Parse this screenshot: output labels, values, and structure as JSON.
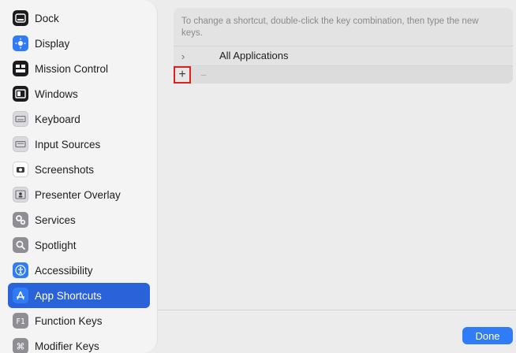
{
  "sidebar": {
    "items": [
      {
        "label": "Dock",
        "icon": "dock-icon",
        "style": "ic-dark"
      },
      {
        "label": "Display",
        "icon": "display-icon",
        "style": "ic-blue"
      },
      {
        "label": "Mission Control",
        "icon": "mission-control-icon",
        "style": "ic-dark"
      },
      {
        "label": "Windows",
        "icon": "windows-icon",
        "style": "ic-dark"
      },
      {
        "label": "Keyboard",
        "icon": "keyboard-icon",
        "style": "ic-light"
      },
      {
        "label": "Input Sources",
        "icon": "input-sources-icon",
        "style": "ic-light"
      },
      {
        "label": "Screenshots",
        "icon": "screenshots-icon",
        "style": "ic-white"
      },
      {
        "label": "Presenter Overlay",
        "icon": "presenter-overlay-icon",
        "style": "ic-light"
      },
      {
        "label": "Services",
        "icon": "services-icon",
        "style": "ic-gray"
      },
      {
        "label": "Spotlight",
        "icon": "spotlight-icon",
        "style": "ic-gray"
      },
      {
        "label": "Accessibility",
        "icon": "accessibility-icon",
        "style": "ic-blue"
      },
      {
        "label": "App Shortcuts",
        "icon": "app-shortcuts-icon",
        "style": "ic-blue",
        "selected": true
      },
      {
        "label": "Function Keys",
        "icon": "function-keys-icon",
        "style": "ic-gray"
      },
      {
        "label": "Modifier Keys",
        "icon": "modifier-keys-icon",
        "style": "ic-gray"
      }
    ]
  },
  "main": {
    "hint": "To change a shortcut, double-click the key combination, then type the new keys.",
    "app_row": {
      "label": "All Applications",
      "chevron": "›"
    },
    "toolbar": {
      "add": "+",
      "remove": "−"
    }
  },
  "footer": {
    "done_label": "Done"
  },
  "colors": {
    "accent": "#2f7cf6",
    "selection": "#2962d9",
    "highlight_box": "#e0201c"
  }
}
